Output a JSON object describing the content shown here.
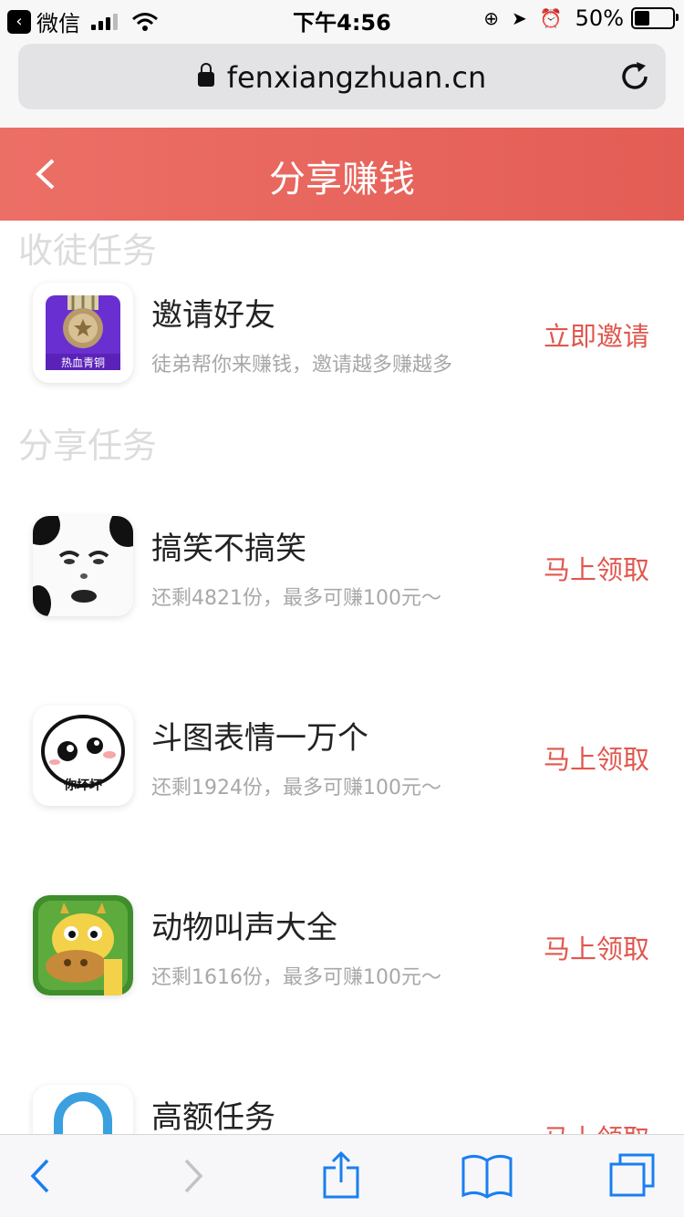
{
  "status_bar": {
    "back_app_label": "微信",
    "time": "下午4:56",
    "battery_percent": "50%",
    "battery_level": 0.5
  },
  "browser": {
    "url": "fenxiangzhuan.cn"
  },
  "header": {
    "title": "分享赚钱"
  },
  "sections": [
    {
      "title": "收徒任务",
      "tasks": [
        {
          "title": "邀请好友",
          "subtitle": "徒弟帮你来赚钱，邀请越多赚越多",
          "action": "立即邀请",
          "icon_label": "热血青铜",
          "icon": "bronze-medal-icon"
        }
      ]
    },
    {
      "title": "分享任务",
      "tasks": [
        {
          "title": "搞笑不搞笑",
          "subtitle": "还剩4821份，最多可赚100元～",
          "action": "马上领取",
          "icon": "panda-face-icon"
        },
        {
          "title": "斗图表情一万个",
          "subtitle": "还剩1924份，最多可赚100元～",
          "action": "马上领取",
          "icon_label": "你坏坏",
          "icon": "emoji-face-icon"
        },
        {
          "title": "动物叫声大全",
          "subtitle": "还剩1616份，最多可赚100元～",
          "action": "马上领取",
          "icon": "giraffe-icon"
        },
        {
          "title": "高额任务",
          "subtitle": "",
          "action": "马上领取",
          "icon": "padlock-icon"
        }
      ]
    }
  ],
  "colors": {
    "header_red": "#e35d55",
    "action_red": "#e0574e",
    "ios_blue": "#1a7ff0"
  }
}
